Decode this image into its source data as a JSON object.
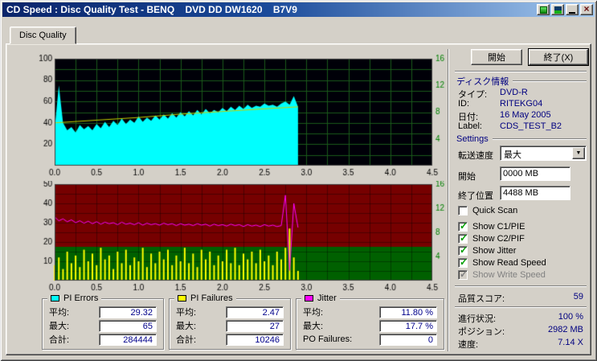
{
  "window": {
    "title": "CD Speed : Disc Quality Test - BENQ    DVD DD DW1620    B7V9"
  },
  "tabs": {
    "disc_quality": "Disc Quality"
  },
  "actions": {
    "start": "開始",
    "exit": "終了(X)"
  },
  "disc_info": {
    "header": "ディスク情報",
    "rows": [
      {
        "label": "タイプ:",
        "value": "DVD-R"
      },
      {
        "label": "ID:",
        "value": "RITEKG04"
      },
      {
        "label": "日付:",
        "value": "16 May 2005"
      },
      {
        "label": "Label:",
        "value": "CDS_TEST_B2"
      }
    ]
  },
  "settings": {
    "header": "Settings",
    "speed_label": "転送速度",
    "speed_value": "最大",
    "start_label": "開始",
    "start_value": "0000 MB",
    "end_label": "終了位置",
    "end_value": "4488 MB",
    "checkboxes": [
      {
        "label": "Quick Scan",
        "checked": false,
        "disabled": false
      },
      {
        "label": "Show C1/PIE",
        "checked": true,
        "disabled": false
      },
      {
        "label": "Show C2/PIF",
        "checked": true,
        "disabled": false
      },
      {
        "label": "Show Jitter",
        "checked": true,
        "disabled": false
      },
      {
        "label": "Show Read Speed",
        "checked": true,
        "disabled": false
      },
      {
        "label": "Show Write Speed",
        "checked": true,
        "disabled": true
      }
    ]
  },
  "status": {
    "score_label": "品質スコア:",
    "score_value": "59",
    "progress_label": "進行状況:",
    "progress_value": "100 %",
    "position_label": "ポジション:",
    "position_value": "2982 MB",
    "speed_label": "速度:",
    "speed_value": "7.14 X"
  },
  "stats": {
    "pi_errors": {
      "title": "PI Errors",
      "swatch": "#00ffff",
      "rows": [
        {
          "label": "平均:",
          "value": "29.32"
        },
        {
          "label": "最大:",
          "value": "65"
        },
        {
          "label": "合計:",
          "value": "284444"
        }
      ]
    },
    "pi_failures": {
      "title": "PI Failures",
      "swatch": "#ffff00",
      "rows": [
        {
          "label": "平均:",
          "value": "2.47"
        },
        {
          "label": "最大:",
          "value": "27"
        },
        {
          "label": "合計:",
          "value": "10246"
        }
      ]
    },
    "jitter": {
      "title": "Jitter",
      "swatch": "#ff00ff",
      "rows": [
        {
          "label": "平均:",
          "value": "11.80 %"
        },
        {
          "label": "最大:",
          "value": "17.7 %"
        },
        {
          "label": "PO Failures:",
          "value": "0"
        }
      ]
    }
  },
  "chart_data": [
    {
      "type": "area",
      "title": "PI Errors (C1/PIE) and Read Speed vs position (GB)",
      "x_max": 4.5,
      "x_step": 0.05,
      "x_tick_step": 0.5,
      "x_ticks": [
        "0.0",
        "0.5",
        "1.0",
        "1.5",
        "2.0",
        "2.5",
        "3.0",
        "3.5",
        "4.0",
        "4.5"
      ],
      "y_left_max": 100,
      "y_left_ticks": [
        100,
        80,
        60,
        40,
        20
      ],
      "y_right_max": 16,
      "y_right_ticks": [
        16,
        12,
        8,
        4
      ],
      "grid_x_step": 0.25,
      "grid_y_step": 10,
      "bg": "#000008",
      "grid_color": "#1a5a1a",
      "right_axis_color": "#008000",
      "series": [
        {
          "name": "PI Errors",
          "type": "area",
          "axis": "left",
          "color": "#00ffff",
          "values": [
            34,
            75,
            40,
            33,
            36,
            31,
            38,
            34,
            37,
            33,
            39,
            35,
            41,
            36,
            42,
            38,
            44,
            39,
            43,
            40,
            46,
            41,
            45,
            42,
            47,
            43,
            48,
            44,
            49,
            45,
            50,
            46,
            51,
            47,
            52,
            48,
            53,
            49,
            52,
            50,
            54,
            51,
            55,
            52,
            56,
            53,
            57,
            54,
            56,
            55,
            58,
            56,
            57,
            55,
            58,
            60,
            57,
            65,
            55
          ]
        },
        {
          "name": "Read Speed",
          "type": "line",
          "axis": "right",
          "color": "#c8d200",
          "points": [
            [
              0,
              6.4
            ],
            [
              0.5,
              6.8
            ],
            [
              1.0,
              7.2
            ],
            [
              1.5,
              7.7
            ],
            [
              2.0,
              8.1
            ],
            [
              2.5,
              8.5
            ],
            [
              2.9,
              8.8
            ]
          ]
        }
      ]
    },
    {
      "type": "bar",
      "title": "PI Failures (C2/PIF) and Jitter vs position (GB)",
      "x_max": 4.5,
      "x_step": 0.05,
      "x_tick_step": 0.5,
      "x_ticks": [
        "0.0",
        "0.5",
        "1.0",
        "1.5",
        "2.0",
        "2.5",
        "3.0",
        "3.5",
        "4.0",
        "4.5"
      ],
      "y_left_max": 50,
      "y_left_ticks": [
        50,
        40,
        30,
        20,
        10
      ],
      "y_right_max": 16,
      "y_right_ticks": [
        16,
        12,
        8,
        4
      ],
      "grid_x_step": 0.25,
      "grid_y_step": 5,
      "zones": [
        {
          "from": 0,
          "to": 17.5,
          "color": "#006000"
        },
        {
          "from": 17.5,
          "to": 50,
          "color": "#760000"
        }
      ],
      "grid_color": "rgba(0,0,0,0.35)",
      "right_axis_color": "#008000",
      "series": [
        {
          "name": "PI Failures",
          "type": "bars",
          "axis": "left",
          "color": "#ffff00",
          "values": [
            8,
            12,
            6,
            15,
            9,
            13,
            7,
            16,
            10,
            14,
            8,
            17,
            11,
            13,
            6,
            15,
            9,
            16,
            8,
            12,
            10,
            17,
            7,
            14,
            9,
            15,
            11,
            16,
            8,
            13,
            10,
            17,
            9,
            14,
            7,
            16,
            11,
            15,
            8,
            13,
            10,
            16,
            9,
            17,
            8,
            14,
            11,
            15,
            9,
            16,
            10,
            13,
            8,
            15,
            11,
            17,
            27,
            12,
            5
          ]
        },
        {
          "name": "Jitter (%)",
          "type": "line",
          "axis": "left",
          "scale": 2.5,
          "color": "#ff00ff",
          "values": [
            13.2,
            12.4,
            12.8,
            12.2,
            12.6,
            12.0,
            12.4,
            11.9,
            12.3,
            11.8,
            12.2,
            11.7,
            12.1,
            11.8,
            12.0,
            11.6,
            12.1,
            11.7,
            11.9,
            11.6,
            12.0,
            11.5,
            11.9,
            11.6,
            11.8,
            11.5,
            11.9,
            11.6,
            11.8,
            11.4,
            11.8,
            11.5,
            11.7,
            11.4,
            11.8,
            11.5,
            11.7,
            11.3,
            11.7,
            11.4,
            11.6,
            11.3,
            11.7,
            11.4,
            11.6,
            11.2,
            11.6,
            11.3,
            11.5,
            11.2,
            11.6,
            11.3,
            11.5,
            11.2,
            11.4,
            17.7,
            2.1,
            16.0,
            11.0
          ]
        }
      ]
    }
  ]
}
